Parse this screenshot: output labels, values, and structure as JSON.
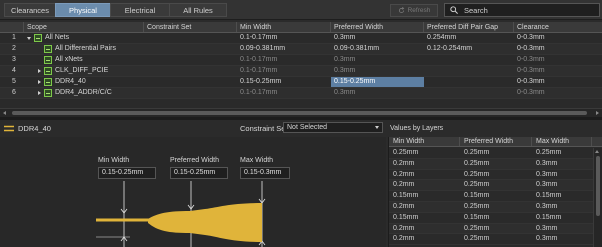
{
  "tabs": [
    {
      "label": "Clearances",
      "active": false
    },
    {
      "label": "Physical",
      "active": true
    },
    {
      "label": "Electrical",
      "active": false
    },
    {
      "label": "All Rules",
      "active": false
    }
  ],
  "refresh_label": "Refresh",
  "search": {
    "placeholder": "Search",
    "value": ""
  },
  "grid": {
    "columns": [
      "",
      "Scope",
      "Constraint Set",
      "Min Width",
      "Preferred Width",
      "Preferred Diff Pair Gap",
      "Clearance"
    ],
    "rows": [
      {
        "num": "1",
        "scope": "All Nets",
        "expand": "down",
        "indent": 0,
        "cset": "",
        "min": "0.1-0.17mm",
        "pref": "0.3mm",
        "gap": "0.254mm",
        "clear": "0-0.3mm",
        "dim": false
      },
      {
        "num": "2",
        "scope": "All Differential Pairs",
        "expand": "none",
        "indent": 1,
        "cset": "",
        "min": "0.09-0.381mm",
        "pref": "0.09-0.381mm",
        "gap": "0.12-0.254mm",
        "clear": "0-0.3mm",
        "dim": false
      },
      {
        "num": "3",
        "scope": "All xNets",
        "expand": "none",
        "indent": 1,
        "cset": "",
        "min": "0.1-0.17mm",
        "pref": "0.3mm",
        "gap": "",
        "clear": "0-0.3mm",
        "dim": true
      },
      {
        "num": "4",
        "scope": "CLK_DIFF_PCIE",
        "expand": "right",
        "indent": 1,
        "cset": "",
        "min": "0.1-0.17mm",
        "pref": "0.3mm",
        "gap": "",
        "clear": "0-0.3mm",
        "dim": true
      },
      {
        "num": "5",
        "scope": "DDR4_40",
        "expand": "right",
        "indent": 1,
        "cset": "",
        "min": "0.15-0.25mm",
        "pref": "0.15-0.25mm",
        "gap": "",
        "clear": "0-0.3mm",
        "dim": false,
        "selected": true
      },
      {
        "num": "6",
        "scope": "DDR4_ADDR/C/C",
        "expand": "right",
        "indent": 1,
        "cset": "",
        "min": "0.1-0.17mm",
        "pref": "0.3mm",
        "gap": "",
        "clear": "0-0.3mm",
        "dim": true
      }
    ]
  },
  "editor": {
    "title": "DDR4_40",
    "constraint_set_label": "Constraint Set",
    "constraint_set_value": "Not Selected",
    "min_width_label": "Min Width",
    "min_width_value": "0.15-0.25mm",
    "pref_width_label": "Preferred Width",
    "pref_width_value": "0.15-0.25mm",
    "max_width_label": "Max Width",
    "max_width_value": "0.15-0.3mm"
  },
  "layers": {
    "title": "Values by Layers",
    "columns": [
      "Min Width",
      "Preferred Width",
      "Max Width"
    ],
    "rows": [
      [
        "0.25mm",
        "0.25mm",
        "0.25mm"
      ],
      [
        "0.2mm",
        "0.25mm",
        "0.3mm"
      ],
      [
        "0.2mm",
        "0.25mm",
        "0.3mm"
      ],
      [
        "0.2mm",
        "0.25mm",
        "0.3mm"
      ],
      [
        "0.15mm",
        "0.15mm",
        "0.15mm"
      ],
      [
        "0.2mm",
        "0.25mm",
        "0.3mm"
      ],
      [
        "0.15mm",
        "0.15mm",
        "0.15mm"
      ],
      [
        "0.2mm",
        "0.25mm",
        "0.3mm"
      ],
      [
        "0.2mm",
        "0.25mm",
        "0.3mm"
      ]
    ]
  },
  "colors": {
    "accent": "#6b8cad",
    "selected_cell": "#5d7fa3",
    "trace": "#e0b43a",
    "net_icon": "#7ec84a"
  }
}
